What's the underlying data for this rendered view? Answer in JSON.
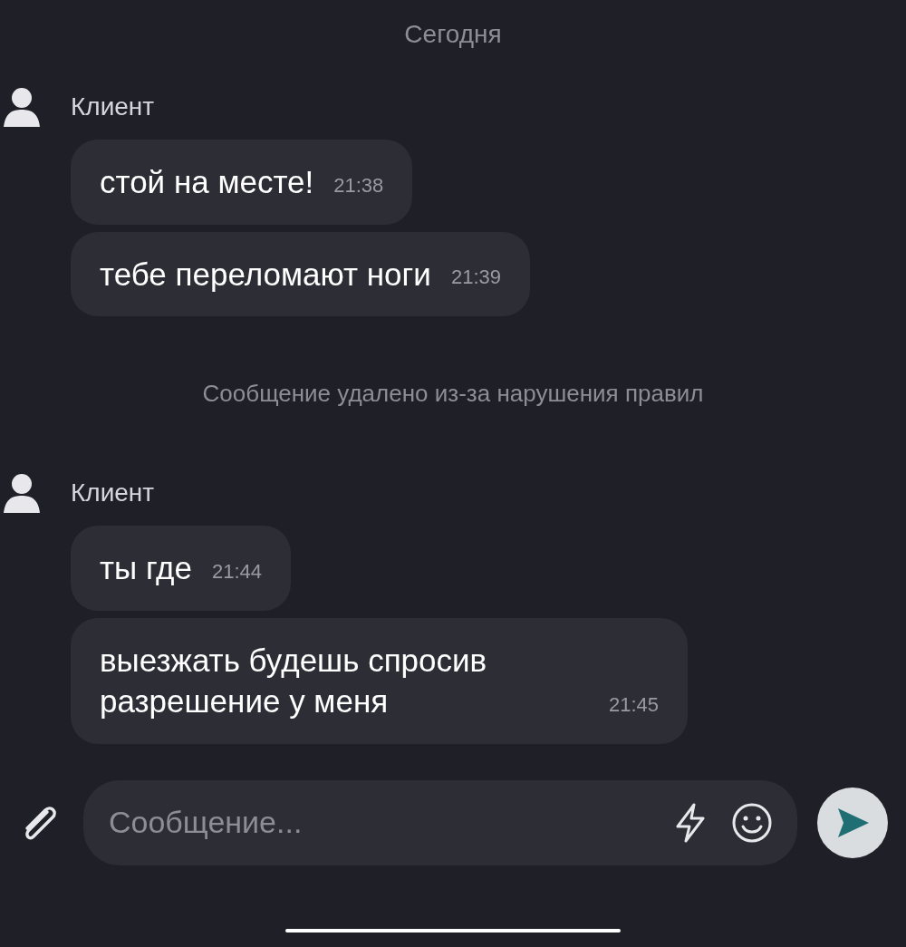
{
  "date_separator": "Сегодня",
  "items": [
    {
      "kind": "group",
      "sender": "Клиент",
      "messages": [
        {
          "text": "стой на месте!",
          "time": "21:38"
        },
        {
          "text": "тебе переломают ноги",
          "time": "21:39"
        }
      ]
    },
    {
      "kind": "system",
      "text": "Сообщение удалено из-за нарушения правил"
    },
    {
      "kind": "group",
      "sender": "Клиент",
      "messages": [
        {
          "text": "ты где",
          "time": "21:44"
        },
        {
          "text": "выезжать будешь спросив разрешение у меня",
          "time": "21:45"
        }
      ]
    }
  ],
  "composer": {
    "placeholder": "Сообщение..."
  }
}
